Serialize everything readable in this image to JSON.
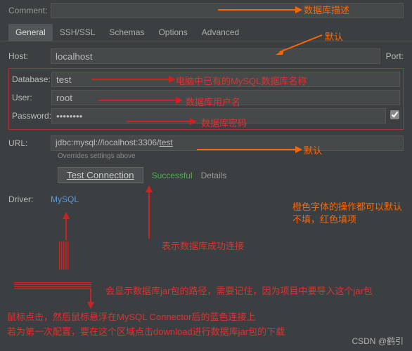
{
  "comment": {
    "label": "Comment:",
    "value": ""
  },
  "tabs": {
    "general": "General",
    "sshssl": "SSH/SSL",
    "schemas": "Schemas",
    "options": "Options",
    "advanced": "Advanced"
  },
  "host": {
    "label": "Host:",
    "value": "localhost",
    "port_label": "Port:"
  },
  "database": {
    "label": "Database:",
    "value": "test"
  },
  "user": {
    "label": "User:",
    "value": "root"
  },
  "password": {
    "label": "Password:",
    "value": "••••••••"
  },
  "url": {
    "label": "URL:",
    "prefix": "jdbc:mysql://localhost:3306/",
    "dbname": "test",
    "override": "Overrides settings above"
  },
  "test": {
    "button": "Test Connection",
    "status": "Successful",
    "details": "Details"
  },
  "driver": {
    "label": "Driver:",
    "value": "MySQL"
  },
  "annotations": {
    "db_desc": "数据库描述",
    "default": "默认",
    "db_name": "电脑中已有的MySQL数据库名称",
    "user_name": "数据库用户名",
    "password": "数据库密码",
    "orange_note": "橙色字体的操作都可以默认不填，红色填项",
    "success_note": "表示数据库成功连接",
    "jar_path": "会显示数据库jar包的路径，需要记住，因为项目中要导入这个jar包",
    "hover_note": "鼠标点击，然后鼠标悬浮在MySQL Connector后的蓝色连接上",
    "download_note": "若为第一次配置，要在这个区域点击download进行数据库jar包的下载"
  },
  "watermark": "CSDN @鹤引"
}
